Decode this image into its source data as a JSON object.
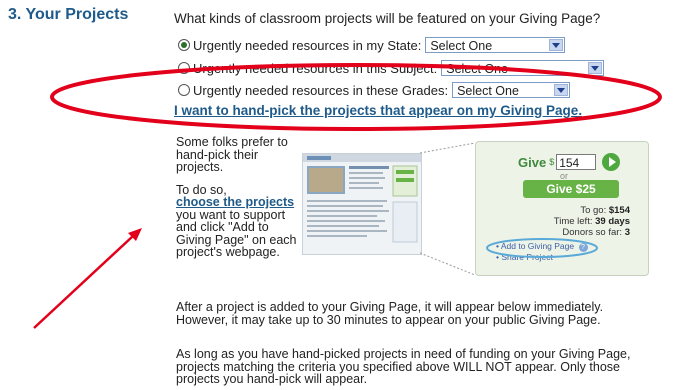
{
  "section": {
    "title": "3. Your Projects",
    "question": "What kinds of classroom projects will be featured on your Giving Page?"
  },
  "options": [
    {
      "label": "Urgently needed resources in my State:",
      "select_value": "Select One",
      "selected": true
    },
    {
      "label": "Urgently needed resources in this Subject:",
      "select_value": "Select One",
      "selected": false
    },
    {
      "label": "Urgently needed resources in these Grades:",
      "select_value": "Select One",
      "selected": false
    }
  ],
  "handpick_link": "I want to hand-pick the projects that appear on my Giving Page.",
  "instructions": {
    "intro": "Some folks prefer to hand-pick their projects.",
    "to_do_so": "To do so,",
    "choose_link": "choose the projects",
    "rest": "you want to support and click \"Add to Giving Page\" on each project's webpage."
  },
  "paragraphs": [
    "After a project is added to your Giving Page, it will appear below immediately. However, it may take up to 30 minutes to appear on your public Giving Page.",
    "As long as you have hand-picked projects in need of funding on your Giving Page, projects matching the criteria you specified above WILL NOT appear. Only those projects you hand-pick will appear."
  ],
  "widget": {
    "give_label": "Give",
    "currency": "$",
    "amount_value": "154",
    "or_text": "or",
    "give_button": "Give $25",
    "to_go_label": "To go:",
    "to_go_value": "$154",
    "time_left_label": "Time left:",
    "time_left_value": "39 days",
    "donors_label": "Donors so far:",
    "donors_value": "3",
    "add_link": "Add to Giving Page",
    "share_link": "Share Project"
  },
  "colors": {
    "title_blue": "#1e5a8a",
    "annotation_red": "#e3001b",
    "give_green": "#67b346",
    "oval_blue": "#5aaad8"
  }
}
